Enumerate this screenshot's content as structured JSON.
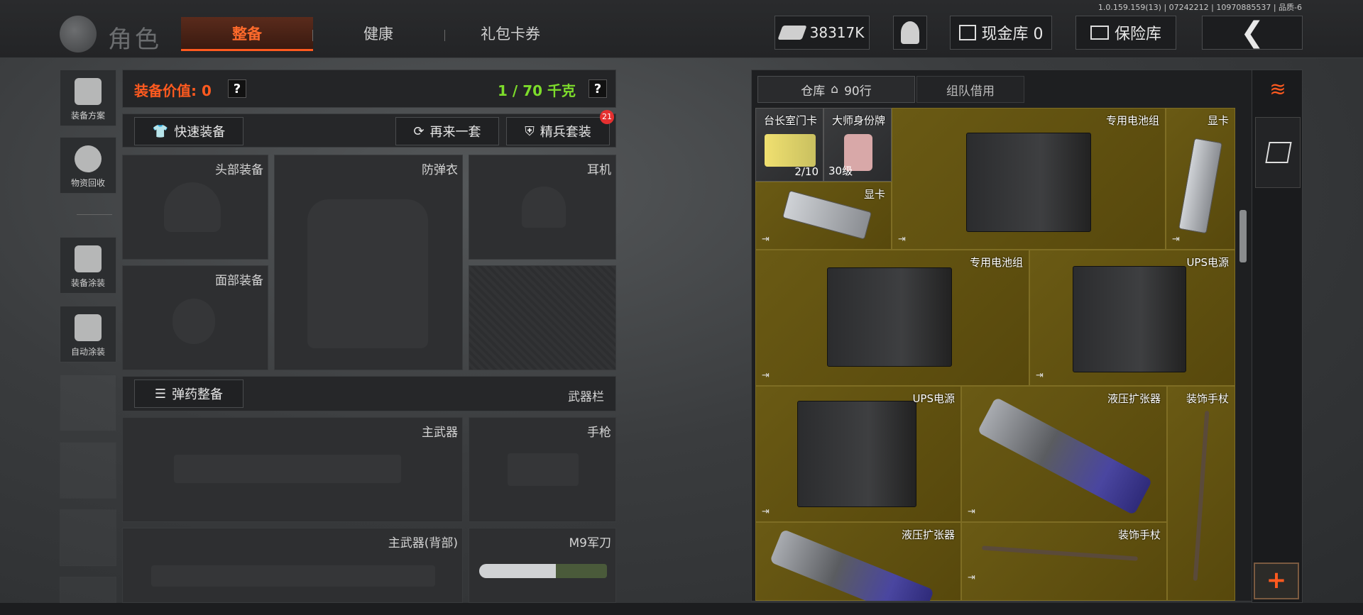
{
  "version": "1.0.159.159(13) | 07242212 | 10970885537 | 品质-6",
  "header": {
    "role": "角色",
    "tabs": [
      "整备",
      "健康",
      "礼包卡券"
    ],
    "money": "38317K",
    "cash_vault": "现金库 0",
    "safe": "保险库"
  },
  "sidebar": [
    "装备方案",
    "物资回收",
    "装备涂装",
    "自动涂装"
  ],
  "equip": {
    "value_label": "装备价值: 0",
    "weight": "1 / 70 千克",
    "quick_equip": "快速装备",
    "again": "再来一套",
    "elite": "精兵套装",
    "elite_badge": "21",
    "slots": {
      "head": "头部装备",
      "armor": "防弹衣",
      "ear": "耳机",
      "face": "面部装备"
    },
    "ammo": "弹药整备",
    "weapon_bar": "武器栏",
    "primary": "主武器",
    "pistol": "手枪",
    "primary_back": "主武器(背部)",
    "knife": "M9军刀"
  },
  "warehouse": {
    "tab_main": "仓库",
    "rows": "90行",
    "tab_team": "组队借用",
    "items": [
      {
        "label": "台长室门卡",
        "count": "2/10"
      },
      {
        "label": "大师身份牌",
        "count": "30级"
      },
      {
        "label": "专用电池组"
      },
      {
        "label": "显卡"
      },
      {
        "label": "显卡"
      },
      {
        "label": "专用电池组"
      },
      {
        "label": "UPS电源"
      },
      {
        "label": "UPS电源"
      },
      {
        "label": "液压扩张器"
      },
      {
        "label": "装饰手杖"
      },
      {
        "label": "液压扩张器"
      },
      {
        "label": "装饰手杖"
      }
    ]
  },
  "colors": {
    "accent": "#ff5a1f",
    "green": "#7ddc2b",
    "yellow_cell": "#5e4e10"
  }
}
